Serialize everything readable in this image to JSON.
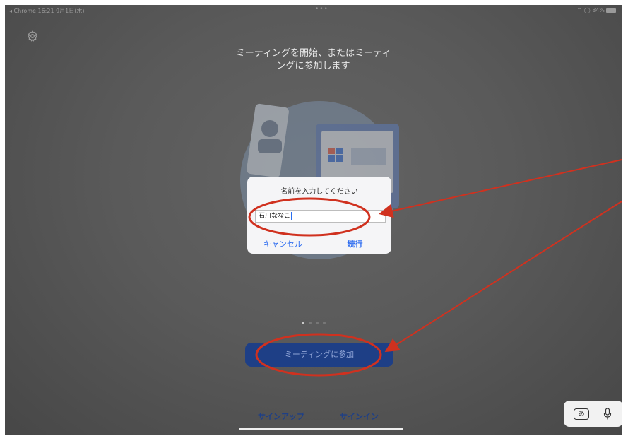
{
  "status_bar": {
    "left": "◂ Chrome  16:21  9月1日(木)",
    "center": "•••",
    "right": "⌔ ◯ 84%"
  },
  "heading": {
    "line1": "ミーティングを開始、またはミーティ",
    "line2": "ングに参加します"
  },
  "dialog": {
    "title": "名前を入力してください",
    "name_value": "石川ななこ",
    "cancel_label": "キャンセル",
    "continue_label": "続行"
  },
  "page_indicator": {
    "count": 4,
    "active_index": 0
  },
  "join_button_label": "ミーティングに参加",
  "bottom_links": {
    "signup": "サインアップ",
    "signin": "サインイン"
  },
  "keyboard_bar": {
    "kana_key": "あ"
  },
  "icons": [
    "gear-icon",
    "mic-icon",
    "battery-icon"
  ],
  "colors": {
    "accent": "#2d6cf0",
    "join_button": "#1e3f86",
    "annotation": "#d0311f"
  }
}
